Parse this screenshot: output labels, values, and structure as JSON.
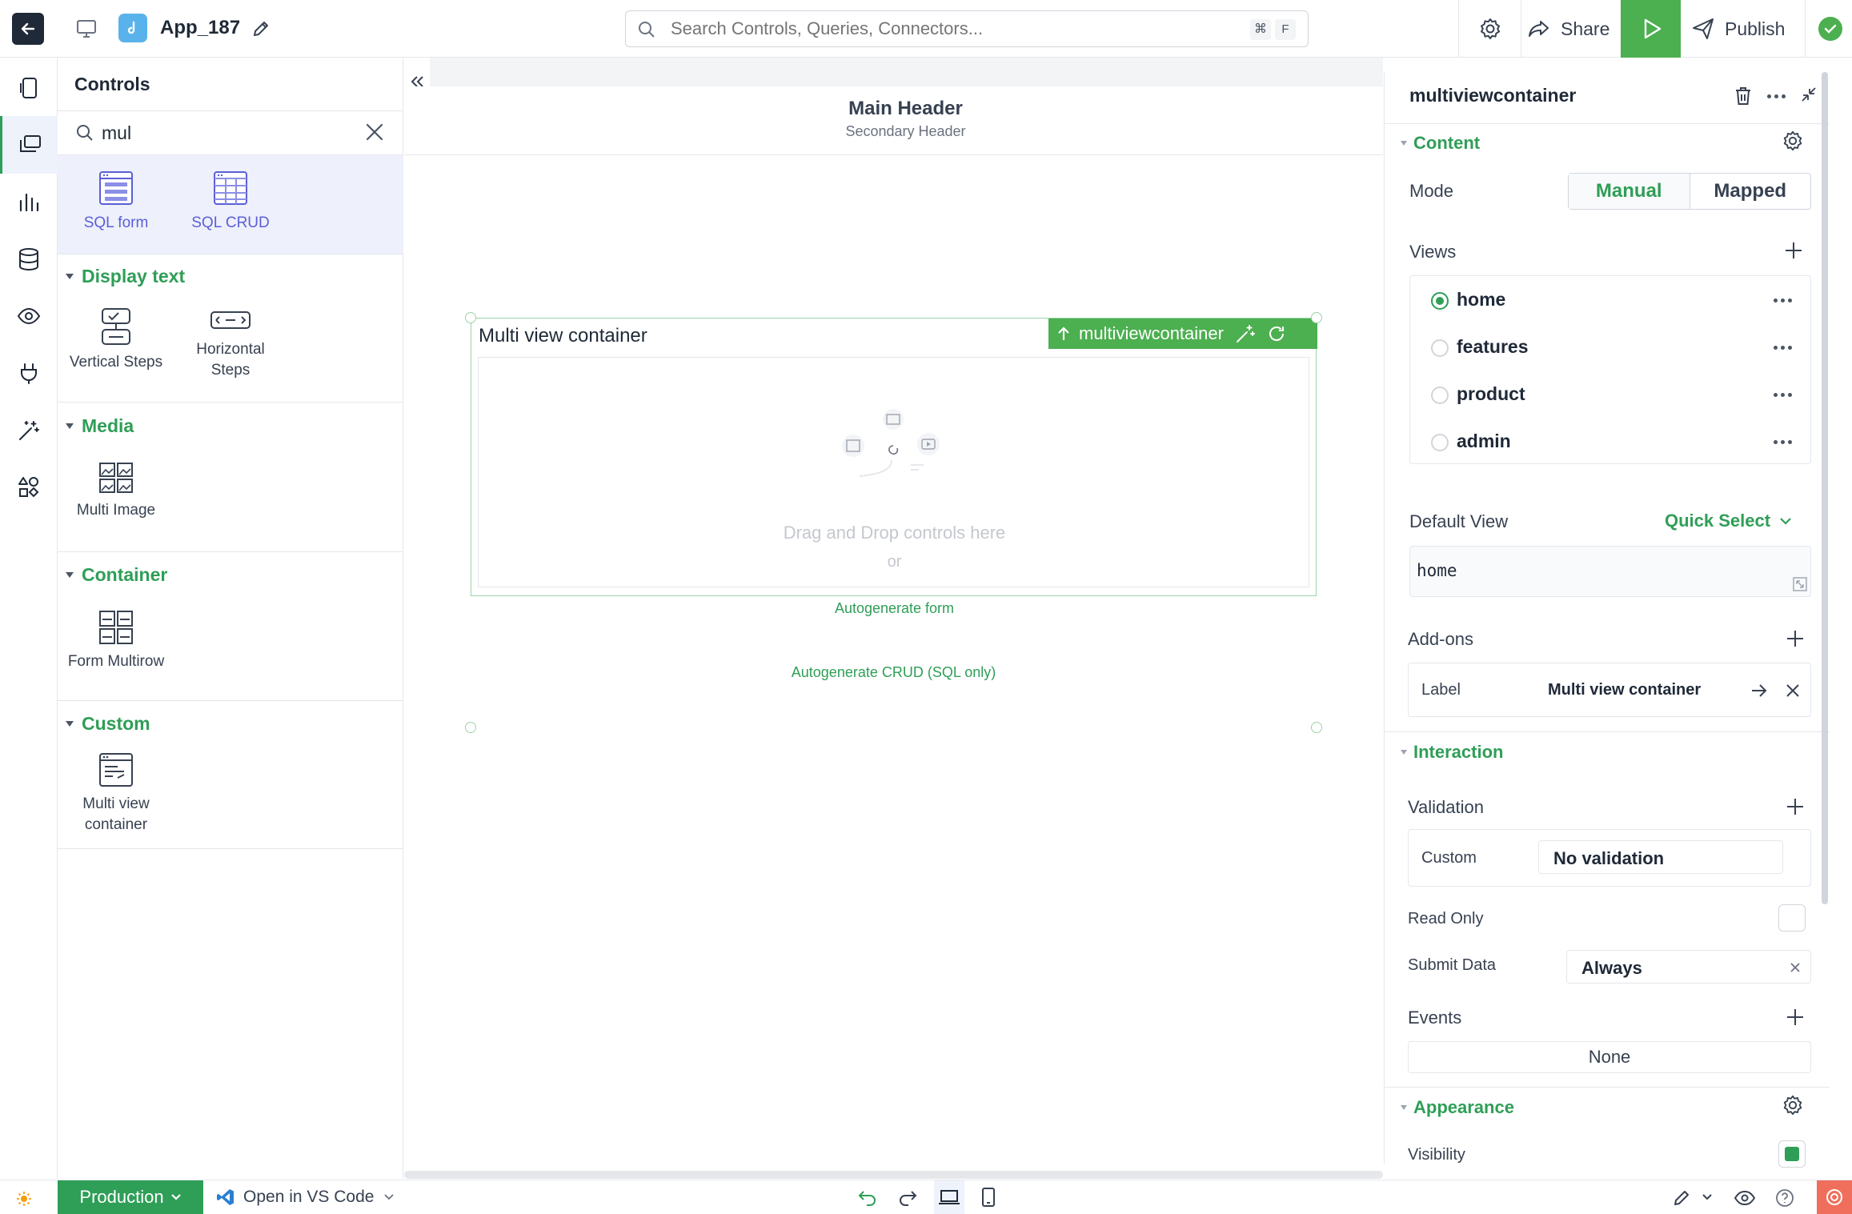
{
  "topbar": {
    "app_name": "App_187",
    "search_placeholder": "Search Controls, Queries, Connectors...",
    "shortcut_cmd": "⌘",
    "shortcut_key": "F",
    "share_label": "Share",
    "publish_label": "Publish"
  },
  "left_panel": {
    "title": "Controls",
    "search_value": "mul",
    "top_items": [
      {
        "label": "SQL form",
        "icon": "sql-form-icon"
      },
      {
        "label": "SQL CRUD",
        "icon": "sql-crud-icon"
      }
    ],
    "sections": [
      {
        "title": "Display text",
        "items": [
          {
            "label": "Vertical Steps"
          },
          {
            "label": "Horizontal Steps"
          }
        ]
      },
      {
        "title": "Media",
        "items": [
          {
            "label": "Multi Image"
          }
        ]
      },
      {
        "title": "Container",
        "items": [
          {
            "label": "Form Multirow"
          }
        ]
      },
      {
        "title": "Custom",
        "items": [
          {
            "label": "Multi view container"
          }
        ]
      }
    ]
  },
  "canvas": {
    "main_header": "Main Header",
    "secondary_header": "Secondary Header",
    "container_title": "Multi view container",
    "badge_label": "multiviewcontainer",
    "drop_text": "Drag and Drop controls here",
    "or_text": "or",
    "autogen_form": "Autogenerate form",
    "autogen_crud": "Autogenerate CRUD (SQL only)"
  },
  "right_panel": {
    "title": "multiviewcontainer",
    "content_section": "Content",
    "mode_label": "Mode",
    "mode_options": [
      "Manual",
      "Mapped"
    ],
    "mode_selected": "Manual",
    "views_label": "Views",
    "views": [
      "home",
      "features",
      "product",
      "admin"
    ],
    "views_selected": "home",
    "default_view_label": "Default View",
    "quick_select_label": "Quick Select",
    "default_view_value": "home",
    "addons_label": "Add-ons",
    "addon_key": "Label",
    "addon_value": "Multi view container",
    "interaction_section": "Interaction",
    "validation_label": "Validation",
    "validation_key": "Custom",
    "validation_value": "No validation",
    "read_only_label": "Read Only",
    "submit_data_label": "Submit Data",
    "submit_data_value": "Always",
    "events_label": "Events",
    "events_value": "None",
    "appearance_section": "Appearance",
    "visibility_label": "Visibility"
  },
  "bottombar": {
    "env_label": "Production",
    "vscode_label": "Open in VS Code"
  },
  "colors": {
    "accent": "#2f9e57",
    "accent_light": "#4caf50",
    "selected_bg": "#eef0fb",
    "sql_icon": "#5b5fd6"
  }
}
